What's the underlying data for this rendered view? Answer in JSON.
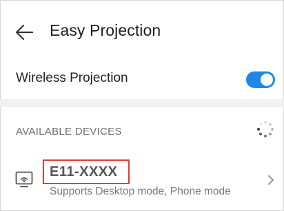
{
  "header": {
    "title": "Easy Projection",
    "back_icon": "arrow-left-icon"
  },
  "wireless": {
    "label": "Wireless Projection",
    "enabled": true,
    "accent": "#1e88e5"
  },
  "devices": {
    "section_title": "AVAILABLE DEVICES",
    "loading_icon": "spinner-icon",
    "items": [
      {
        "name": "E11-XXXX",
        "subtitle": "Supports Desktop mode, Phone mode",
        "icon": "screen-cast-icon",
        "highlight_color": "#e53935"
      }
    ]
  }
}
